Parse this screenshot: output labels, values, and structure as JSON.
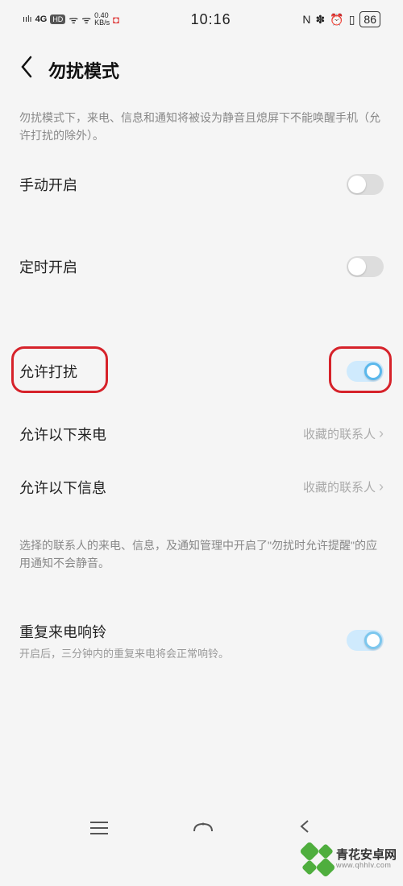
{
  "status": {
    "signal": "ıılı",
    "net": "4G",
    "hd": "HD",
    "wifi1": "⦿",
    "wifi2": "⦿",
    "rate": "0.40\nKB/s",
    "app": "◘",
    "time": "10:16",
    "nfc": "N",
    "bt": "✽",
    "alarm": "⏰",
    "vib": "▯",
    "battery": "86"
  },
  "header": {
    "title": "勿扰模式"
  },
  "desc1": "勿扰模式下，来电、信息和通知将被设为静音且熄屏下不能唤醒手机（允许打扰的除外）。",
  "rows": {
    "manual": {
      "label": "手动开启",
      "on": false
    },
    "scheduled": {
      "label": "定时开启",
      "on": false
    },
    "allow": {
      "label": "允许打扰",
      "on": true
    },
    "allowCalls": {
      "label": "允许以下来电",
      "value": "收藏的联系人"
    },
    "allowMsg": {
      "label": "允许以下信息",
      "value": "收藏的联系人"
    },
    "repeat": {
      "label": "重复来电响铃",
      "sub": "开启后，三分钟内的重复来电将会正常响铃。",
      "on": true
    }
  },
  "desc2": "选择的联系人的来电、信息，及通知管理中开启了\"勿扰时允许提醒\"的应用通知不会静音。",
  "watermark": {
    "cn": "青花安卓网",
    "en": "www.qhhlv.com"
  }
}
